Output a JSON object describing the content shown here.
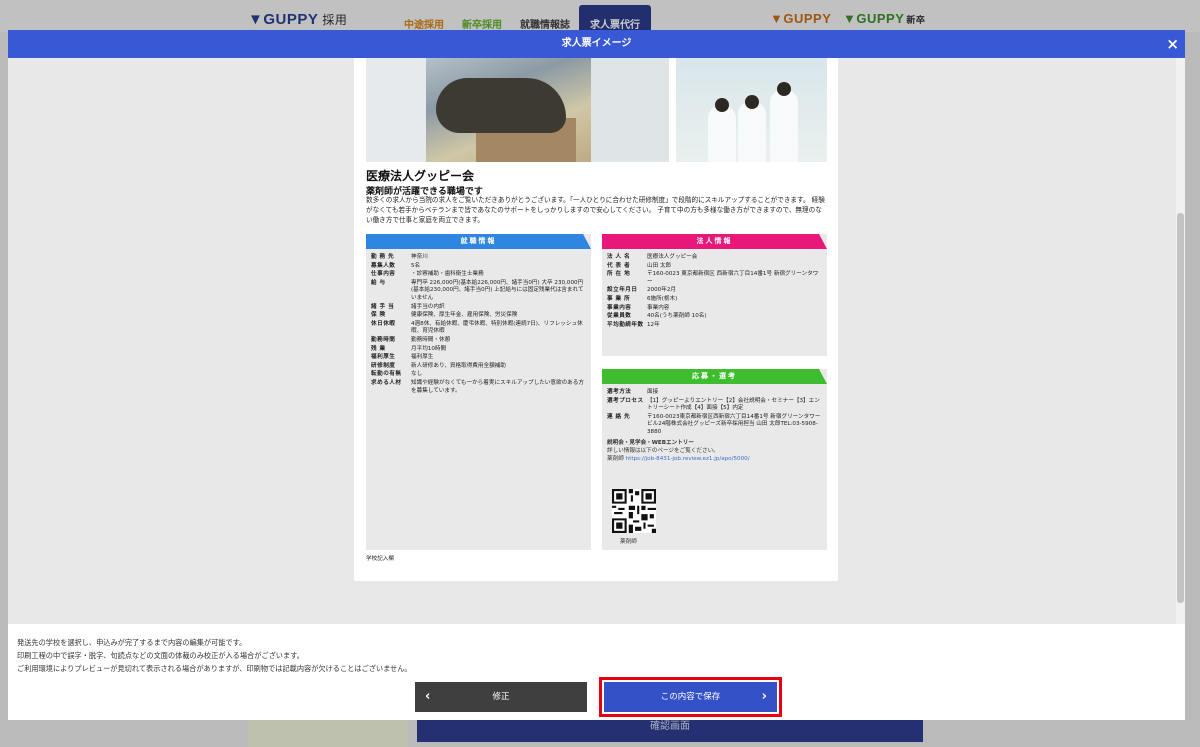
{
  "site": {
    "logo_main": "GUPPY",
    "logo_main_sub": "採用",
    "nav": [
      "中途採用",
      "新卒採用",
      "就職情報誌",
      "求人票代行"
    ],
    "logo_right1": "GUPPY",
    "logo_right2": "GUPPY",
    "logo_right2_sub": "新卒",
    "bg_button": "確認画面"
  },
  "modal": {
    "title": "求人票イメージ",
    "close": "×"
  },
  "document": {
    "org_name": "医療法人グッピー会",
    "catch": "薬剤師が活躍できる職場です",
    "intro": "数多くの求人から当院の求人をご覧いただきありがとうございます。「一人ひとりに合わせた研修制度」で段階的にスキルアップすることができます。 経験がなくても若手からベテランまで皆であなたのサポートをしっかりしますので安心してください。 子育て中の方も多様な働き方ができますので、無理のない働き方で仕事と家庭を両立できます。",
    "job_title": "就職情報",
    "job_rows": [
      {
        "k": "勤 務 先",
        "v": "神奈川"
      },
      {
        "k": "募集人数",
        "v": "5名"
      },
      {
        "k": "仕事内容",
        "v": "・診察補助・歯科衛生士業務"
      },
      {
        "k": "給 与",
        "v": "専門卒 226,000円(基本給226,000円、諸手当0円) 大卒 230,000円(基本給230,000円、諸手当0円) 上記給与には固定残業代は含まれていません"
      },
      {
        "k": "諸 手 当",
        "v": "諸手当の内訳"
      },
      {
        "k": "保 険",
        "v": "健康保険、厚生年金、雇用保険、労災保険"
      },
      {
        "k": "休日休暇",
        "v": "4週8休、有給休暇、慶弔休暇、特別休暇(連続7日)、リフレッシュ休暇、育児休暇"
      },
      {
        "k": "勤務時間",
        "v": "勤務時間・休憩"
      },
      {
        "k": "残 業",
        "v": "月平均10時間"
      },
      {
        "k": "福利厚生",
        "v": "福利厚生"
      },
      {
        "k": "研修制度",
        "v": "新人研修あり、資格取得費用全額補助"
      },
      {
        "k": "転勤の有無",
        "v": "なし"
      },
      {
        "k": "求める人材",
        "v": "知識や経験がなくても一から着実にスキルアップしたい意欲のある方を募集しています。"
      }
    ],
    "corp_title": "法人情報",
    "corp_rows": [
      {
        "k": "法 人 名",
        "v": "医療法人グッピー会"
      },
      {
        "k": "代 表 者",
        "v": "山田 太郎"
      },
      {
        "k": "所 在 地",
        "v": "〒160-0023 東京都新宿区 西新宿六丁目14番1号 新宿グリーンタワー"
      },
      {
        "k": "設立年月日",
        "v": "2000年2月"
      },
      {
        "k": "事 業 所",
        "v": "6施所(栃木)"
      },
      {
        "k": "事業内容",
        "v": "事業内容"
      },
      {
        "k": "従業員数",
        "v": "40名(うち薬剤師 10名)"
      },
      {
        "k": "平均勤続年数",
        "v": "12年"
      }
    ],
    "apply_title": "応募・選考",
    "apply_rows": [
      {
        "k": "選考方法",
        "v": "面接"
      },
      {
        "k": "選考プロセス",
        "v": "【1】グッピーよりエントリー【2】会社説明会・セミナー【3】エントリーシート作成【4】面接【5】内定"
      },
      {
        "k": "連 絡 先",
        "v": "〒160-0023東京都新宿区西新宿六丁目14番1号 新宿グリーンタワービル24階株式会社グッピーズ新卒採用担当 山田 太郎TEL:03-5908-3880"
      }
    ],
    "entry_title": "説明会・見学会・WEBエントリー",
    "entry_text": "詳しい情報は以下のページをご覧ください。",
    "entry_link_label": "薬剤師",
    "entry_link": "https://job-8431-job.review.ez1.jp/apo/5000/",
    "qr_caption": "薬剤師",
    "school_note": "学校記入欄"
  },
  "footer": {
    "notes": [
      "発送先の学校を選択し、申込みが完了するまで内容の編集が可能です。",
      "印刷工程の中で誤字・脱字、句読点などの文面の体裁のみ校正が入る場合がございます。",
      "ご利用環境によりプレビューが見切れて表示される場合がありますが、印刷物では記載内容が欠けることはございません。"
    ],
    "back_label": "修正",
    "save_label": "この内容で保存"
  },
  "colors": {
    "header_blue": "#3858d6",
    "job_blue": "#2f86e0",
    "corp_pink": "#e8177a",
    "apply_green": "#3ebd2e",
    "save_blue": "#3551c8",
    "highlight_red": "#e60012"
  },
  "icons": [
    "close-icon",
    "chevron-left-icon",
    "chevron-right-icon",
    "qr-code-icon"
  ]
}
